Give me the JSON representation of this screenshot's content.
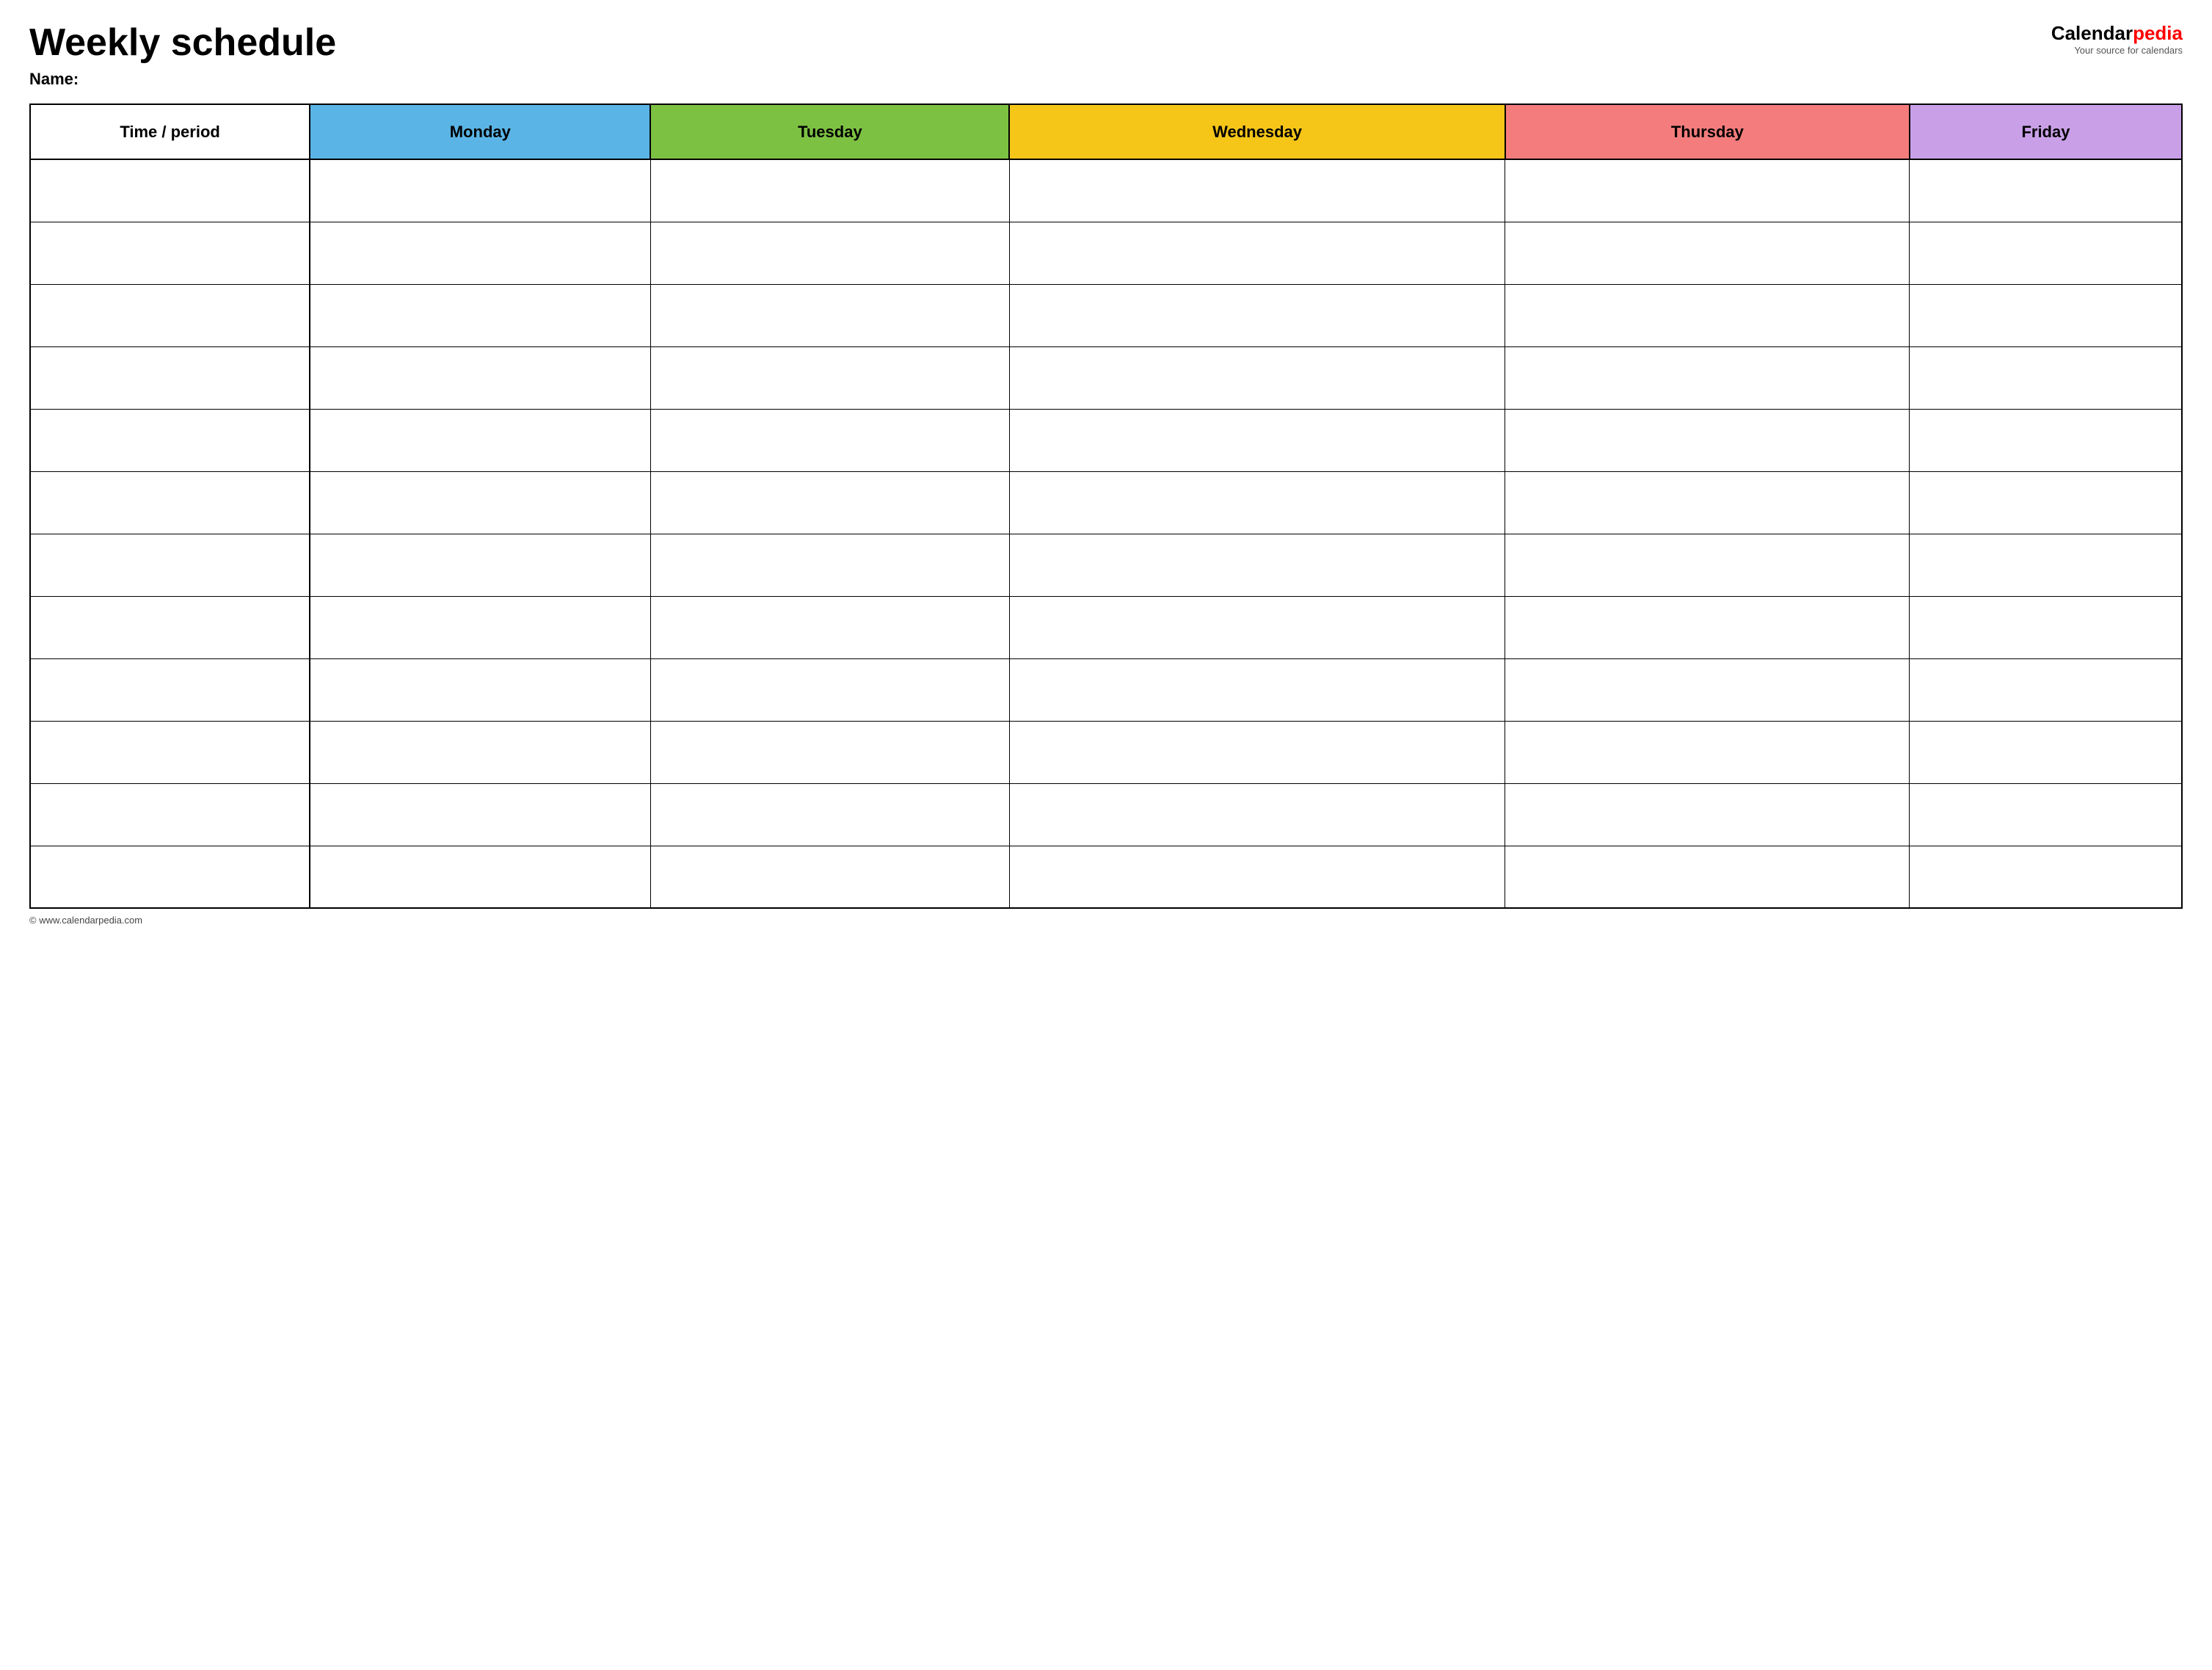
{
  "header": {
    "title": "Weekly schedule",
    "name_label": "Name:",
    "logo_calendar": "Calendar",
    "logo_pedia": "pedia",
    "logo_subtitle": "Your source for calendars"
  },
  "table": {
    "columns": [
      {
        "id": "time",
        "label": "Time / period",
        "color": "#ffffff",
        "text_color": "#000000"
      },
      {
        "id": "monday",
        "label": "Monday",
        "color": "#5ab4e5",
        "text_color": "#000000"
      },
      {
        "id": "tuesday",
        "label": "Tuesday",
        "color": "#7dc143",
        "text_color": "#000000"
      },
      {
        "id": "wednesday",
        "label": "Wednesday",
        "color": "#f5c518",
        "text_color": "#000000"
      },
      {
        "id": "thursday",
        "label": "Thursday",
        "color": "#f47c7c",
        "text_color": "#000000"
      },
      {
        "id": "friday",
        "label": "Friday",
        "color": "#c9a0e8",
        "text_color": "#000000"
      }
    ],
    "row_count": 12
  },
  "footer": {
    "copyright": "© www.calendarpedia.com"
  }
}
